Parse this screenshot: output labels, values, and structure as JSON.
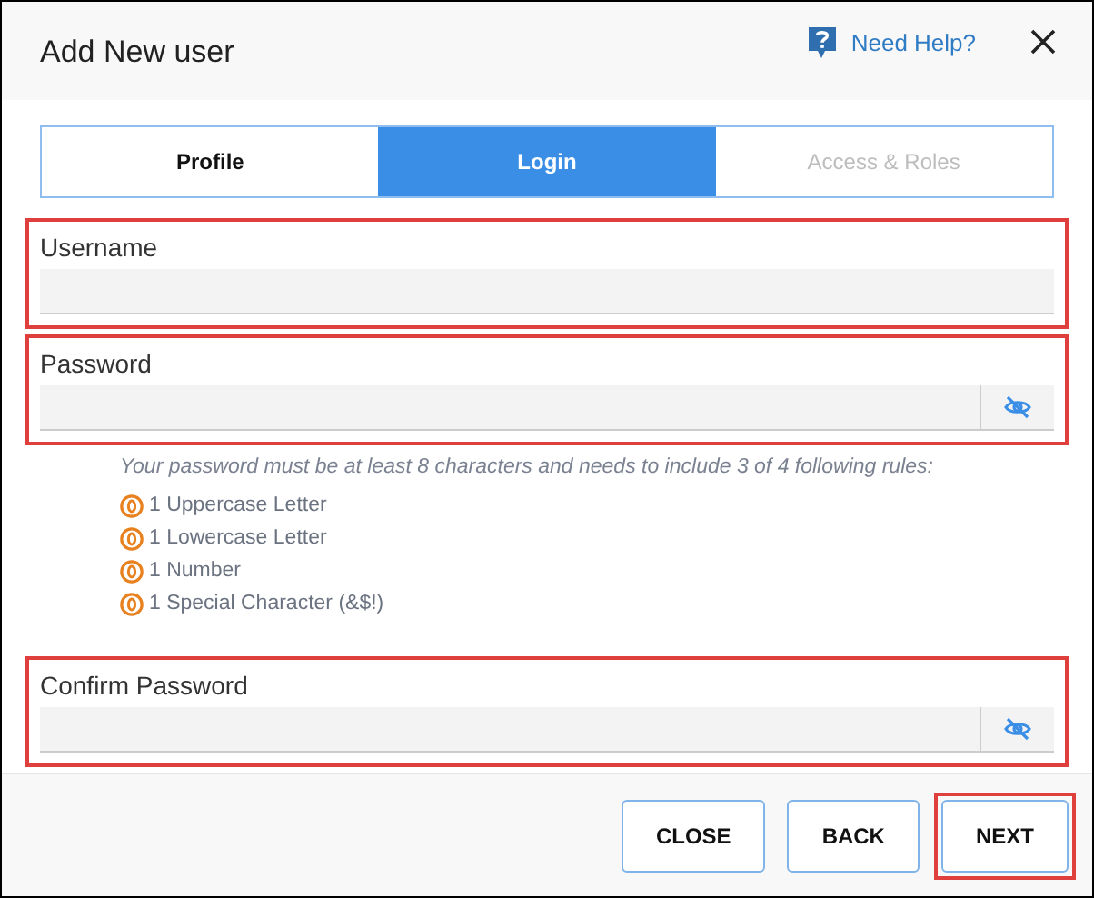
{
  "dialog": {
    "title": "Add New user",
    "help_link": "Need Help?"
  },
  "tabs": [
    {
      "label": "Profile",
      "selected": false,
      "disabled": false
    },
    {
      "label": "Login",
      "selected": true,
      "disabled": false
    },
    {
      "label": "Access & Roles",
      "selected": false,
      "disabled": true
    }
  ],
  "username": {
    "label": "Username",
    "highlighted": true
  },
  "password": {
    "label": "Password",
    "kind": "password",
    "highlighted": true
  },
  "password_rules": {
    "hint": "Your password must be at least 8 characters and needs to include 3 of 4 following rules:",
    "items": [
      {
        "text": "1 Uppercase Letter"
      },
      {
        "text": "1 Lowercase Letter"
      },
      {
        "text": "1 Number"
      },
      {
        "text": "1 Special Character (&$!)"
      }
    ]
  },
  "confirm_password": {
    "label": "Confirm Password",
    "kind": "password",
    "highlighted": true
  },
  "buttons": [
    {
      "label": "CLOSE",
      "highlighted": false
    },
    {
      "label": "BACK",
      "highlighted": false
    },
    {
      "label": "NEXT",
      "highlighted": true
    }
  ]
}
